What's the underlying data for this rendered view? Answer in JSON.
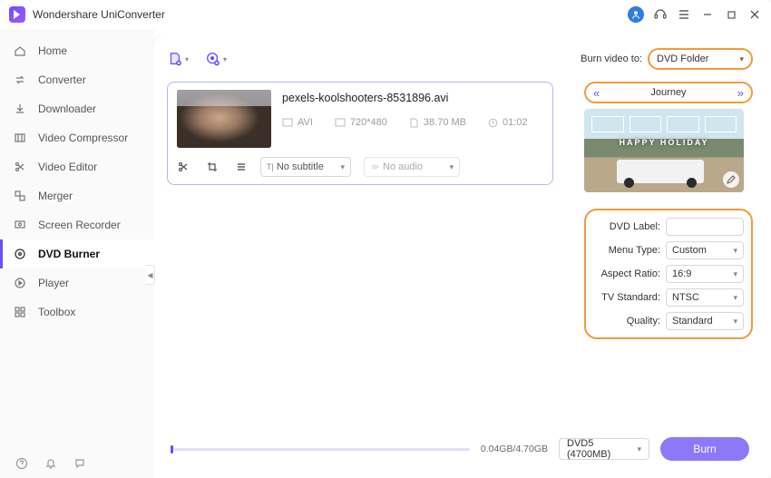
{
  "titlebar": {
    "app": "Wondershare UniConverter"
  },
  "sidebar": {
    "items": [
      {
        "label": "Home"
      },
      {
        "label": "Converter"
      },
      {
        "label": "Downloader"
      },
      {
        "label": "Video Compressor"
      },
      {
        "label": "Video Editor"
      },
      {
        "label": "Merger"
      },
      {
        "label": "Screen Recorder"
      },
      {
        "label": "DVD Burner"
      },
      {
        "label": "Player"
      },
      {
        "label": "Toolbox"
      }
    ]
  },
  "toolbar": {
    "burn_to_label": "Burn video to:",
    "burn_to_value": "DVD Folder"
  },
  "file": {
    "name": "pexels-koolshooters-8531896.avi",
    "format": "AVI",
    "resolution": "720*480",
    "size": "38.70 MB",
    "duration": "01:02",
    "subtitle_label": "No subtitle",
    "audio_label": "No audio"
  },
  "theme": {
    "name": "Journey",
    "overlay": "HAPPY HOLIDAY"
  },
  "settings": {
    "dvd_label_label": "DVD Label:",
    "dvd_label_value": "",
    "menu_type_label": "Menu Type:",
    "menu_type_value": "Custom",
    "aspect_ratio_label": "Aspect Ratio:",
    "aspect_ratio_value": "16:9",
    "tv_standard_label": "TV Standard:",
    "tv_standard_value": "NTSC",
    "quality_label": "Quality:",
    "quality_value": "Standard"
  },
  "footer": {
    "size_text": "0.04GB/4.70GB",
    "disc_value": "DVD5 (4700MB)",
    "burn_label": "Burn"
  }
}
